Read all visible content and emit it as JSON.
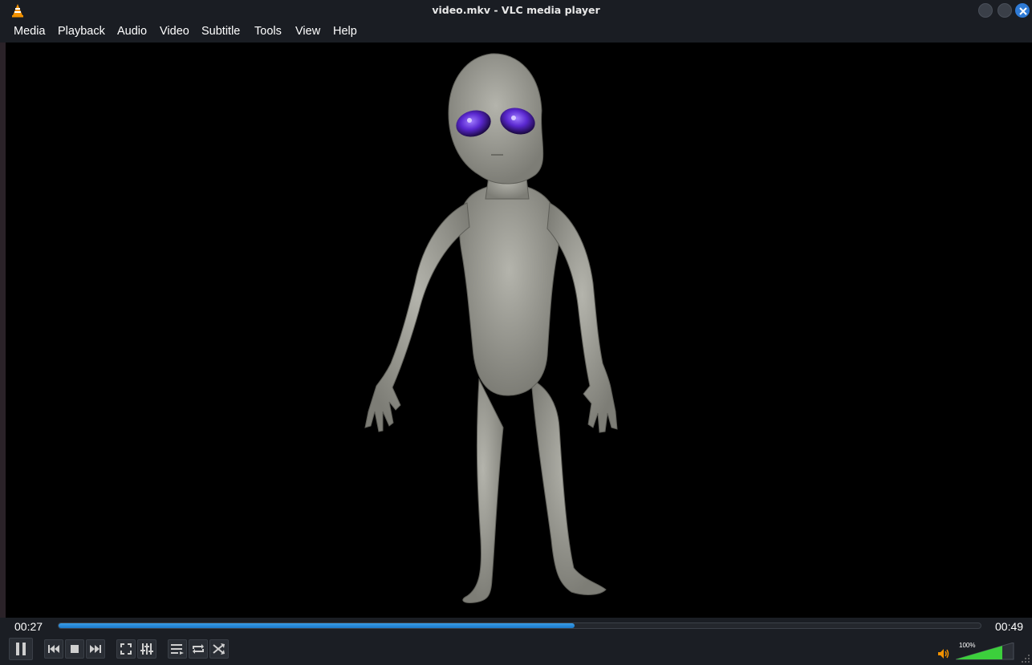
{
  "window": {
    "title": "video.mkv - VLC media player",
    "app_icon": "vlc-cone-icon",
    "buttons": [
      "minimize-icon",
      "maximize-icon",
      "close-icon"
    ]
  },
  "menubar": {
    "items": [
      {
        "label": "Media"
      },
      {
        "label": "Playback"
      },
      {
        "label": "Audio"
      },
      {
        "label": "Video"
      },
      {
        "label": "Subtitle"
      },
      {
        "label": "Tools"
      },
      {
        "label": "View"
      },
      {
        "label": "Help"
      }
    ]
  },
  "video": {
    "content": "grey alien figure with purple eyes on black background"
  },
  "playback": {
    "elapsed": "00:27",
    "total": "00:49",
    "progress": 0.56
  },
  "controls": {
    "buttons": [
      "pause-icon",
      "previous-icon",
      "stop-icon",
      "next-icon",
      "fullscreen-icon",
      "extended-settings-icon",
      "playlist-icon",
      "loop-icon",
      "shuffle-icon"
    ]
  },
  "volume": {
    "label": "100%",
    "level": 1.0
  },
  "colors": {
    "accent": "#2f7bd6",
    "seek_fill": "#1c78c9",
    "volume_fill": "#3ccf3c"
  }
}
